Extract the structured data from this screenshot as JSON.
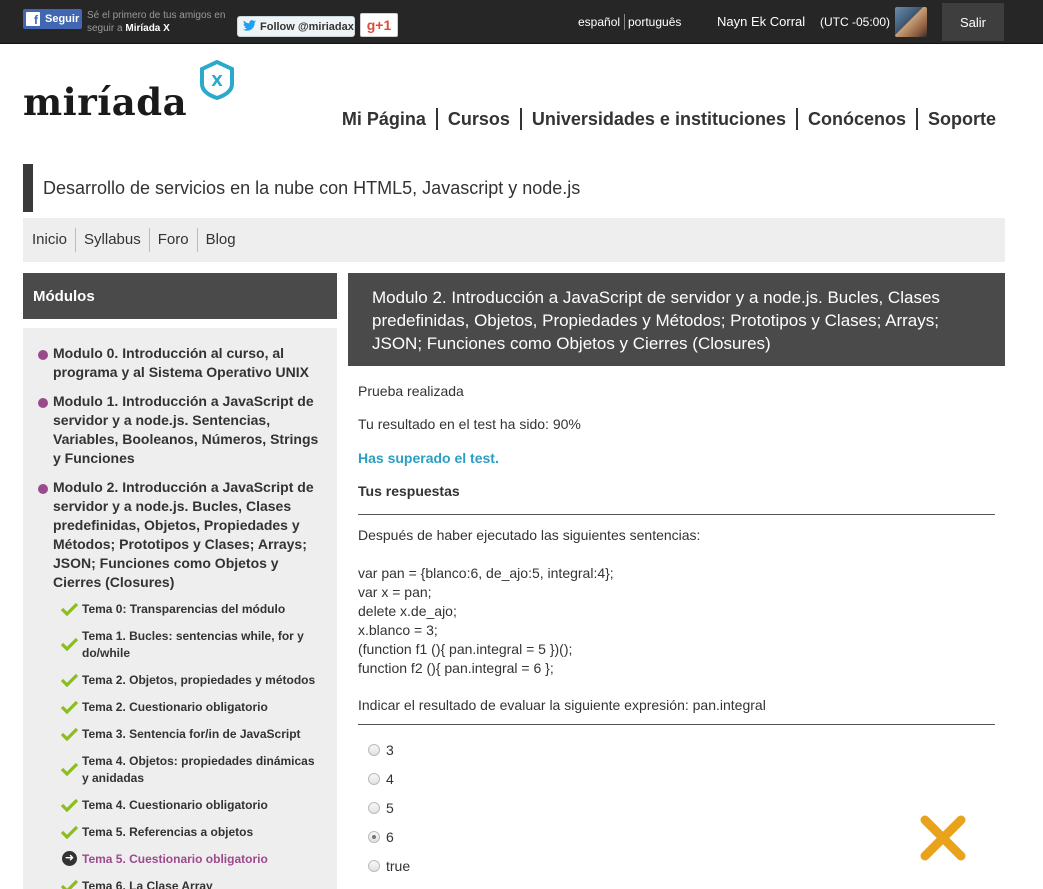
{
  "topbar": {
    "fb_label": "Seguir",
    "fb_text": "Sé el primero de tus amigos en seguir a",
    "fb_brand": "Miríada X",
    "twitter_label": "Follow @miriadax",
    "gplus_label": "g+1",
    "lang_es": "español",
    "lang_pt": "português",
    "username": "Nayn Ek Corral",
    "timezone": "(UTC -05:00)",
    "logout_label": "Salir"
  },
  "header": {
    "logo": "miríada",
    "logo_badge": "X",
    "nav": [
      "Mi Página",
      "Cursos",
      "Universidades e instituciones",
      "Conócenos",
      "Soporte"
    ]
  },
  "course": {
    "title": "Desarrollo de servicios en la nube con HTML5, Javascript y node.js",
    "nav": [
      "Inicio",
      "Syllabus",
      "Foro",
      "Blog"
    ]
  },
  "sidebar": {
    "title": "Módulos",
    "modules": [
      "Modulo 0. Introducción al curso, al programa y al Sistema Operativo UNIX",
      "Modulo 1. Introducción a JavaScript de servidor y a node.js. Sentencias, Variables, Booleanos, Números, Strings y Funciones",
      "Modulo 2. Introducción a JavaScript de servidor y a node.js. Bucles, Clases predefinidas, Objetos, Propiedades y Métodos; Prototipos y Clases; Arrays; JSON; Funciones como Objetos y Cierres (Closures)"
    ],
    "temas": [
      "Tema 0: Transparencias del módulo",
      "Tema 1. Bucles: sentencias while, for y do/while",
      "Tema 2. Objetos, propiedades y métodos",
      "Tema 2. Cuestionario obligatorio",
      "Tema 3. Sentencia for/in de JavaScript",
      "Tema 4. Objetos: propiedades dinámicas y anidadas",
      "Tema 4. Cuestionario obligatorio",
      "Tema 5. Referencias a objetos",
      "Tema 5. Cuestionario obligatorio",
      "Tema 6. La Clase Array"
    ]
  },
  "main": {
    "heading": "Modulo 2. Introducción a JavaScript de servidor y a node.js. Bucles, Clases predefinidas, Objetos, Propiedades y Métodos; Prototipos y Clases; Arrays; JSON; Funciones como Objetos y Cierres (Closures)",
    "status": "Prueba realizada",
    "result": "Tu resultado en el test ha sido: 90%",
    "passed": "Has superado el test.",
    "answers_title": "Tus respuestas",
    "question_intro": "Después de haber ejecutado las siguientes sentencias:",
    "code": [
      "var pan = {blanco:6, de_ajo:5, integral:4};",
      "var x = pan;",
      "delete x.de_ajo;",
      "x.blanco = 3;",
      "(function f1 (){ pan.integral = 5 })();",
      "function f2 (){ pan.integral = 6 };"
    ],
    "question": "Indicar el resultado de evaluar la siguiente expresión: pan.integral",
    "options": [
      "3",
      "4",
      "5",
      "6",
      "true"
    ],
    "selected_option": "6",
    "result_icon": "incorrect-x-icon",
    "accent_color": "#e8a21c"
  }
}
